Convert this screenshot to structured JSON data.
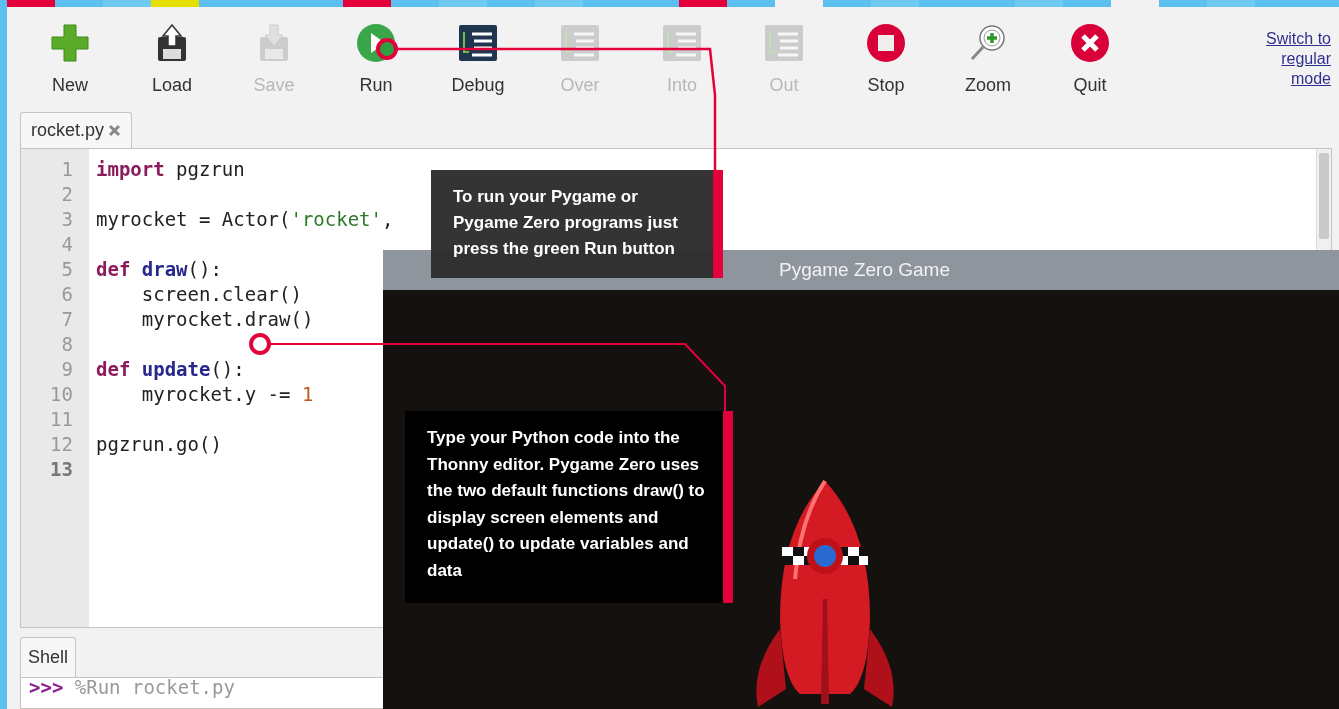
{
  "toolbar": {
    "buttons": [
      {
        "label": "New",
        "kind": "new",
        "disabled": false
      },
      {
        "label": "Load",
        "kind": "load",
        "disabled": false
      },
      {
        "label": "Save",
        "kind": "save",
        "disabled": true
      },
      {
        "label": "Run",
        "kind": "run",
        "disabled": false
      },
      {
        "label": "Debug",
        "kind": "debug",
        "disabled": false
      },
      {
        "label": "Over",
        "kind": "over",
        "disabled": true
      },
      {
        "label": "Into",
        "kind": "into",
        "disabled": true
      },
      {
        "label": "Out",
        "kind": "out",
        "disabled": true
      },
      {
        "label": "Stop",
        "kind": "stop",
        "disabled": false
      },
      {
        "label": "Zoom",
        "kind": "zoom",
        "disabled": false
      },
      {
        "label": "Quit",
        "kind": "quit",
        "disabled": false
      }
    ],
    "mode_link": "Switch to regular mode"
  },
  "editor": {
    "tab": {
      "label": "rocket.py",
      "selected": true
    },
    "lines": [
      {
        "number": "1",
        "current": false,
        "tokens": [
          {
            "text": "import",
            "kind": "keyword"
          },
          {
            "text": " pgzrun",
            "kind": "plain"
          }
        ]
      },
      {
        "number": "2",
        "current": false
      },
      {
        "number": "3",
        "current": false,
        "tokens": [
          {
            "text": "myrocket = Actor(",
            "kind": "plain"
          },
          {
            "text": "'rocket'",
            "kind": "string"
          },
          {
            "text": ",",
            "kind": "plain"
          }
        ]
      },
      {
        "number": "4",
        "current": false
      },
      {
        "number": "5",
        "current": false,
        "tokens": [
          {
            "text": "def ",
            "kind": "keyword"
          },
          {
            "text": "draw",
            "kind": "name"
          },
          {
            "text": "():",
            "kind": "plain"
          }
        ]
      },
      {
        "number": "6",
        "current": false,
        "tokens": [
          {
            "text": "    screen.clear()",
            "kind": "plain"
          }
        ]
      },
      {
        "number": "7",
        "current": false,
        "tokens": [
          {
            "text": "    myrocket.draw()",
            "kind": "plain"
          }
        ]
      },
      {
        "number": "8",
        "current": false
      },
      {
        "number": "9",
        "current": false,
        "tokens": [
          {
            "text": "def ",
            "kind": "keyword"
          },
          {
            "text": "update",
            "kind": "name"
          },
          {
            "text": "():",
            "kind": "plain"
          }
        ]
      },
      {
        "number": "10",
        "current": false,
        "tokens": [
          {
            "text": "    myrocket.y -= ",
            "kind": "plain"
          },
          {
            "text": "1",
            "kind": "number"
          }
        ]
      },
      {
        "number": "11",
        "current": false
      },
      {
        "number": "12",
        "current": false,
        "tokens": [
          {
            "text": "pgzrun.go()",
            "kind": "plain"
          }
        ]
      },
      {
        "number": "13",
        "current": true
      }
    ]
  },
  "shell": {
    "tab": {
      "label": "Shell",
      "selected": true
    },
    "prompt": ">>>",
    "command": "%Run rocket.py"
  },
  "game_window": {
    "title": "Pygame Zero Game"
  },
  "callouts": [
    {
      "text": "To run your Pygame or Pygame Zero programs just press the green Run button"
    },
    {
      "text": "Type your Python code into the Thonny editor. Pygame Zero uses the two default functions draw() to display screen elements and update() to update variables and data"
    }
  ]
}
